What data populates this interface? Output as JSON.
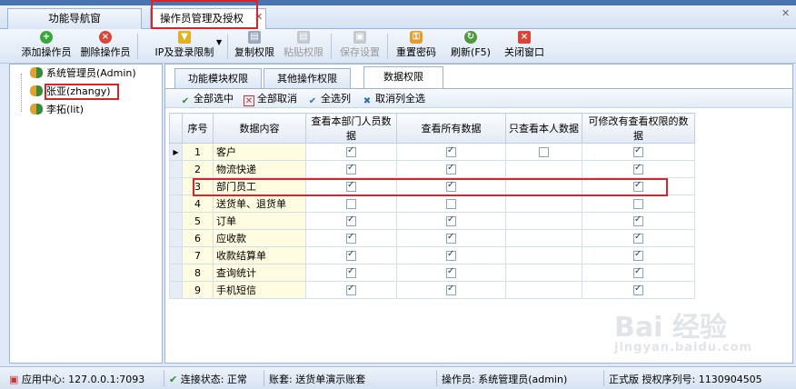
{
  "tabs": [
    {
      "label": "功能导航窗"
    },
    {
      "label": "操作员管理及授权"
    }
  ],
  "toolbar": {
    "add": "添加操作员",
    "delete": "删除操作员",
    "login_limit": "IP及登录限制",
    "copy": "复制权限",
    "paste": "粘贴权限",
    "save": "保存设置",
    "reset_pwd": "重置密码",
    "refresh": "刷新(F5)",
    "close": "关闭窗口"
  },
  "tree": [
    {
      "label": "系统管理员(Admin)"
    },
    {
      "label": "张亚(zhangy)"
    },
    {
      "label": "李拓(lit)"
    }
  ],
  "subtabs": [
    {
      "label": "功能模块权限"
    },
    {
      "label": "其他操作权限"
    },
    {
      "label": "数据权限"
    }
  ],
  "actions": {
    "select_all": "全部选中",
    "cancel_all": "全部取消",
    "select_col": "全选列",
    "cancel_col": "取消列全选"
  },
  "grid": {
    "headers": [
      "序号",
      "数据内容",
      "查看本部门人员数据",
      "查看所有数据",
      "只查看本人数据",
      "可修改有查看权限的数据"
    ],
    "rows": [
      {
        "no": "1",
        "content": "客户",
        "dept": true,
        "all": true,
        "self": false,
        "edit": true
      },
      {
        "no": "2",
        "content": "物流快递",
        "dept": true,
        "all": true,
        "self": null,
        "edit": true
      },
      {
        "no": "3",
        "content": "部门员工",
        "dept": true,
        "all": true,
        "self": null,
        "edit": true
      },
      {
        "no": "4",
        "content": "送货单、退货单",
        "dept": false,
        "all": false,
        "self": null,
        "edit": false
      },
      {
        "no": "5",
        "content": "订单",
        "dept": true,
        "all": true,
        "self": null,
        "edit": true
      },
      {
        "no": "6",
        "content": "应收款",
        "dept": true,
        "all": true,
        "self": null,
        "edit": true
      },
      {
        "no": "7",
        "content": "收款结算单",
        "dept": true,
        "all": true,
        "self": null,
        "edit": true
      },
      {
        "no": "8",
        "content": "查询统计",
        "dept": true,
        "all": true,
        "self": null,
        "edit": true
      },
      {
        "no": "9",
        "content": "手机短信",
        "dept": true,
        "all": true,
        "self": null,
        "edit": true
      }
    ]
  },
  "status": {
    "app_center": "应用中心: 127.0.0.1:7093",
    "conn": "连接状态: 正常",
    "account": "账套: 送货单演示账套",
    "operator": "操作员: 系统管理员(admin)",
    "license": "正式版 授权序列号: 1130904505"
  },
  "watermark": {
    "text": "Bai 经验",
    "sub": "jingyan.baidu.com"
  },
  "colors": {
    "highlight": "#d9242b",
    "accent": "#4a74b0"
  }
}
